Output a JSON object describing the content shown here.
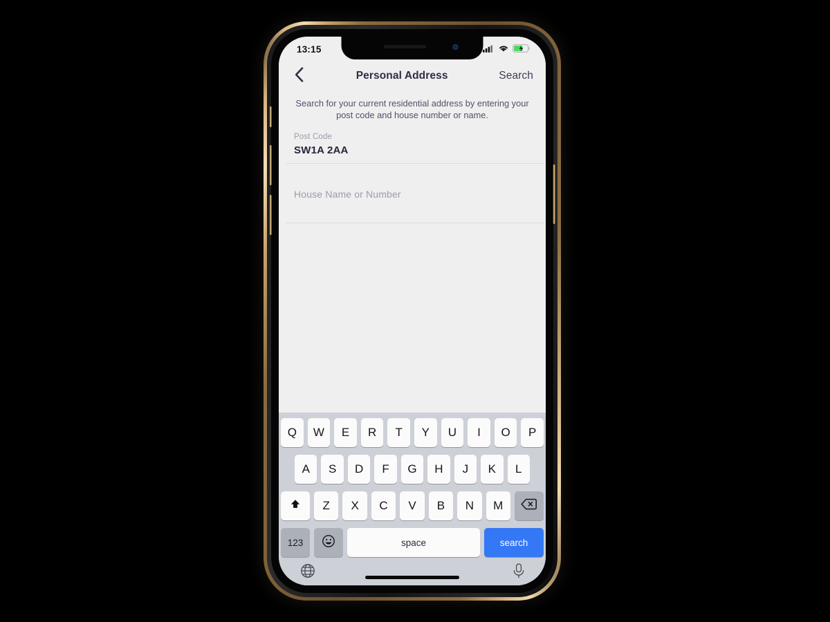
{
  "status_bar": {
    "time": "13:15",
    "signal_icon": "cellular-signal-icon",
    "wifi_icon": "wifi-icon",
    "battery_icon": "battery-charging-icon",
    "battery_color": "#4cd964"
  },
  "nav": {
    "back_icon": "chevron-left-icon",
    "title": "Personal Address",
    "action_label": "Search"
  },
  "subtitle": "Search for your current residential address by entering your post code and house number or name.",
  "form": {
    "fields": [
      {
        "label": "Post Code",
        "value": "SW1A 2AA",
        "placeholder": "Post Code"
      },
      {
        "label": "",
        "value": "",
        "placeholder": "House Name or Number"
      }
    ]
  },
  "keyboard": {
    "row1": [
      "Q",
      "W",
      "E",
      "R",
      "T",
      "Y",
      "U",
      "I",
      "O",
      "P"
    ],
    "row2": [
      "A",
      "S",
      "D",
      "F",
      "G",
      "H",
      "J",
      "K",
      "L"
    ],
    "row3": [
      "Z",
      "X",
      "C",
      "V",
      "B",
      "N",
      "M"
    ],
    "shift_icon": "shift-arrow-icon",
    "backspace_icon": "backspace-delete-icon",
    "numbers_label": "123",
    "emoji_icon": "emoji-smiley-icon",
    "space_label": "space",
    "return_label": "search",
    "return_color": "#3478f6",
    "globe_icon": "globe-language-icon",
    "mic_icon": "microphone-dictation-icon"
  },
  "colors": {
    "screen_bg": "#efefef",
    "keyboard_bg": "#cdd0d6",
    "key_bg": "#fbfbfc",
    "key_dark_bg": "#acb0b9",
    "title_text": "#2d2d44",
    "muted_text": "#9b9bab"
  }
}
